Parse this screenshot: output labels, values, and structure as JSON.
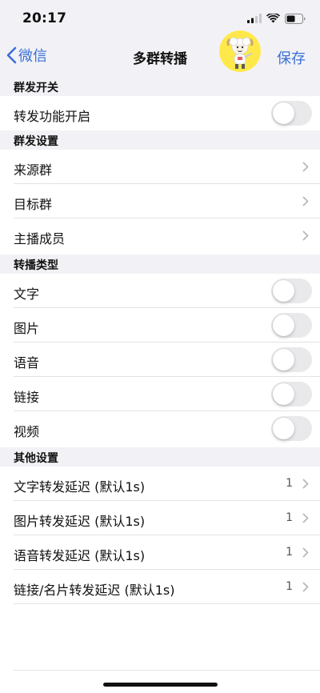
{
  "status_bar": {
    "time": "20:17"
  },
  "nav": {
    "back_label": "微信",
    "title": "多群转播",
    "save_label": "保存"
  },
  "sections": {
    "forward_switch": {
      "header": "群发开关",
      "rows": [
        {
          "label": "转发功能开启",
          "toggle_on": false
        }
      ]
    },
    "group_settings": {
      "header": "群发设置",
      "rows": [
        {
          "label": "来源群"
        },
        {
          "label": "目标群"
        },
        {
          "label": "主播成员"
        }
      ]
    },
    "broadcast_types": {
      "header": "转播类型",
      "rows": [
        {
          "label": "文字",
          "toggle_on": false
        },
        {
          "label": "图片",
          "toggle_on": false
        },
        {
          "label": "语音",
          "toggle_on": false
        },
        {
          "label": "链接",
          "toggle_on": false
        },
        {
          "label": "视频",
          "toggle_on": false
        }
      ]
    },
    "other_settings": {
      "header": "其他设置",
      "rows": [
        {
          "label": "文字转发延迟 (默认1s)",
          "value": "1"
        },
        {
          "label": "图片转发延迟 (默认1s)",
          "value": "1"
        },
        {
          "label": "语音转发延迟 (默认1s)",
          "value": "1"
        },
        {
          "label": "链接/名片转发延迟 (默认1s)",
          "value": "1"
        }
      ]
    }
  },
  "colors": {
    "accent": "#3b6fd6",
    "section_background": "#f2f2f6",
    "toggle_off": "#e9e9eb",
    "divider": "#e3e3e6"
  },
  "icons": {
    "back": "chevron-left-icon",
    "disclosure": "chevron-right-icon",
    "avatar": "cartoon-sheep-avatar"
  }
}
